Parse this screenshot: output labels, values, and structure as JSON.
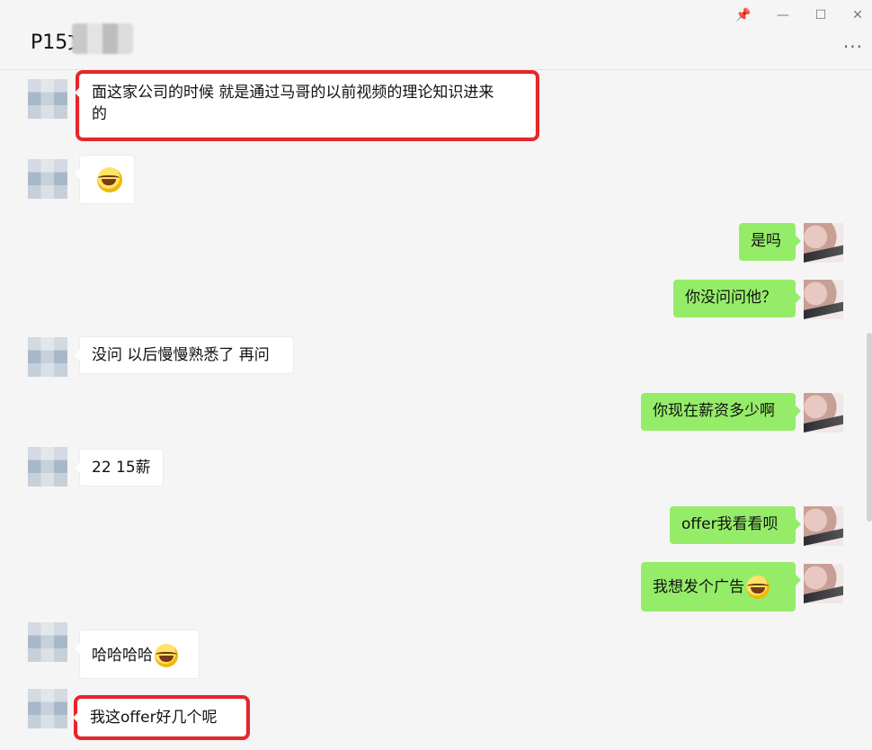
{
  "header": {
    "title": "P15文",
    "pin": "📌",
    "minimize": "—",
    "maximize": "☐",
    "close": "✕",
    "more": "···"
  },
  "messages": [
    {
      "side": "in",
      "text_line1": "面这家公司的时候  就是通过马哥的以前视频的理论知识进来",
      "text_line2": "的",
      "highlight": true
    },
    {
      "side": "in",
      "emoji": "laugh-cry-emoji"
    },
    {
      "side": "out",
      "text": "是吗"
    },
    {
      "side": "out",
      "text": "你没问问他？"
    },
    {
      "side": "in",
      "text": "没问 以后慢慢熟悉了 再问"
    },
    {
      "side": "out",
      "text": "你现在薪资多少啊"
    },
    {
      "side": "in",
      "text": "22 15薪"
    },
    {
      "side": "out",
      "text": "offer我看看呗"
    },
    {
      "side": "out",
      "text": "我想发个广告",
      "emoji": "laugh-cry-emoji"
    },
    {
      "side": "in",
      "text": "哈哈哈哈",
      "emoji": "laugh-cry-emoji"
    },
    {
      "side": "in",
      "text": "我这offer好几个呢",
      "highlight": true
    }
  ],
  "colors": {
    "out_bubble": "#95ec69",
    "in_bubble": "#ffffff",
    "highlight": "#e8252b",
    "background": "#f5f5f5"
  }
}
